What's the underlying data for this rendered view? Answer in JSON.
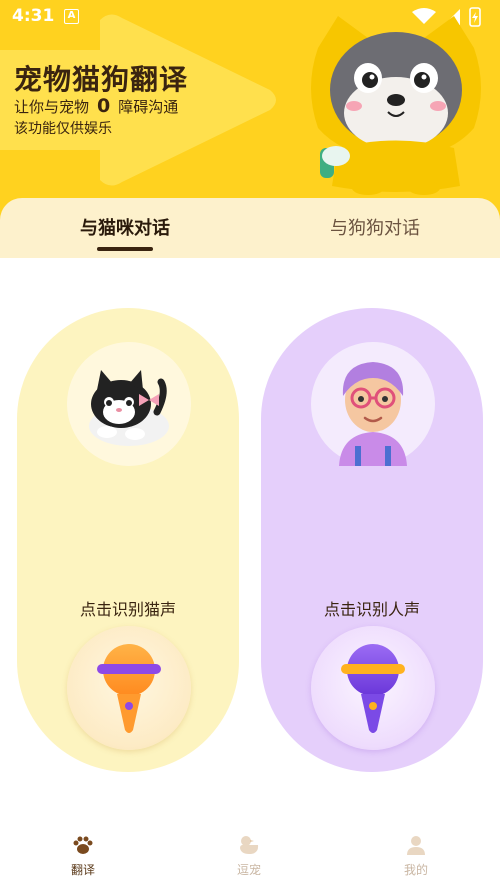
{
  "status_bar": {
    "time": "4:31",
    "notification_icon": "A"
  },
  "hero": {
    "title": "宠物猫狗翻译",
    "subtitle_prefix": "让你与宠物",
    "subtitle_zero": "0",
    "subtitle_suffix": "障碍沟通",
    "disclaimer": "该功能仅供娱乐"
  },
  "tabs": [
    {
      "label": "与猫咪对话",
      "active": true
    },
    {
      "label": "与狗狗对话",
      "active": false
    }
  ],
  "cards": {
    "cat": {
      "label": "点击识别猫声"
    },
    "human": {
      "label": "点击识别人声"
    }
  },
  "bottom_nav": [
    {
      "label": "翻译",
      "icon": "paw-icon",
      "active": true
    },
    {
      "label": "逗宠",
      "icon": "duck-icon",
      "active": false
    },
    {
      "label": "我的",
      "icon": "person-icon",
      "active": false
    }
  ],
  "colors": {
    "header_yellow": "#ffd21f",
    "tab_bg": "#fdf1cc",
    "cat_card": "#fdf4c0",
    "human_card": "#e5cffb",
    "text_brown": "#3a2410"
  }
}
